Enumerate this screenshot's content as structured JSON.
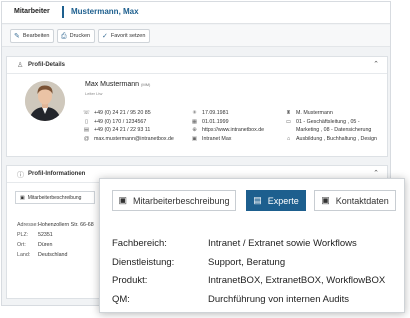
{
  "breadcrumb": {
    "section": "Mitarbeiter",
    "name": "Mustermann, Max"
  },
  "toolbar": {
    "edit": "Bearbeiten",
    "print": "Drucken",
    "favorite": "Favorit setzen"
  },
  "profile": {
    "header": "Profil-Details",
    "name": "Max Mustermann",
    "name_suffix": "(MM)",
    "role": "Leiter Ltw",
    "contact": [
      {
        "icon": "phone-icon",
        "glyph": "☏",
        "value": "+49 (0) 24 21 / 95 20 85"
      },
      {
        "icon": "mobile-icon",
        "glyph": "▯",
        "value": "+49 (0) 170 / 1234567"
      },
      {
        "icon": "fax-icon",
        "glyph": "▤",
        "value": "+49 (0) 24 21 / 22 93 11"
      },
      {
        "icon": "email-icon",
        "glyph": "@",
        "value": "max.mustermann@intranetbox.de"
      }
    ],
    "personal": [
      {
        "icon": "birthday-icon",
        "glyph": "✳",
        "value": "17.09.1981"
      },
      {
        "icon": "calendar-icon",
        "glyph": "▦",
        "value": "01.01.1999"
      },
      {
        "icon": "globe-icon",
        "glyph": "⊕",
        "value": "https://www.intranetbox.de"
      },
      {
        "icon": "intranet-icon",
        "glyph": "▣",
        "value": "Intranet Max"
      }
    ],
    "org": [
      {
        "icon": "manager-icon",
        "glyph": "♜",
        "value": "M. Mustermann"
      },
      {
        "icon": "department-icon",
        "glyph": "▭",
        "value": "01 - Geschäftsleitung , 05 -"
      },
      {
        "icon": "",
        "glyph": "",
        "value": "Marketing , 08 - Datensicherung"
      },
      {
        "icon": "training-icon",
        "glyph": "⌂",
        "value": "Ausbildung , Buchhaltung , Design"
      }
    ]
  },
  "info": {
    "header": "Profil-Informationen",
    "tab": "Mitarbeiterbeschreibung",
    "address": [
      {
        "k": "Adresse:",
        "v": "Hohenzollern Str. 66-68"
      },
      {
        "k": "PLZ:",
        "v": "52351"
      },
      {
        "k": "Ort:",
        "v": "Düren"
      },
      {
        "k": "Land:",
        "v": "Deutschland"
      }
    ]
  },
  "popup": {
    "tabs": [
      "Mitarbeiterbeschreibung",
      "Experte",
      "Kontaktdaten"
    ],
    "active_tab": "Experte",
    "fields": [
      {
        "k": "Fachbereich:",
        "v": "Intranet / Extranet sowie Workflows"
      },
      {
        "k": "Dienstleistung:",
        "v": "Support, Beratung"
      },
      {
        "k": "Produkt:",
        "v": "IntranetBOX, ExtranetBOX, WorkflowBOX"
      },
      {
        "k": "QM:",
        "v": "Durchführung von internen Audits"
      }
    ]
  },
  "colors": {
    "accent": "#1d5f8e",
    "background": "#f1f3f5"
  }
}
